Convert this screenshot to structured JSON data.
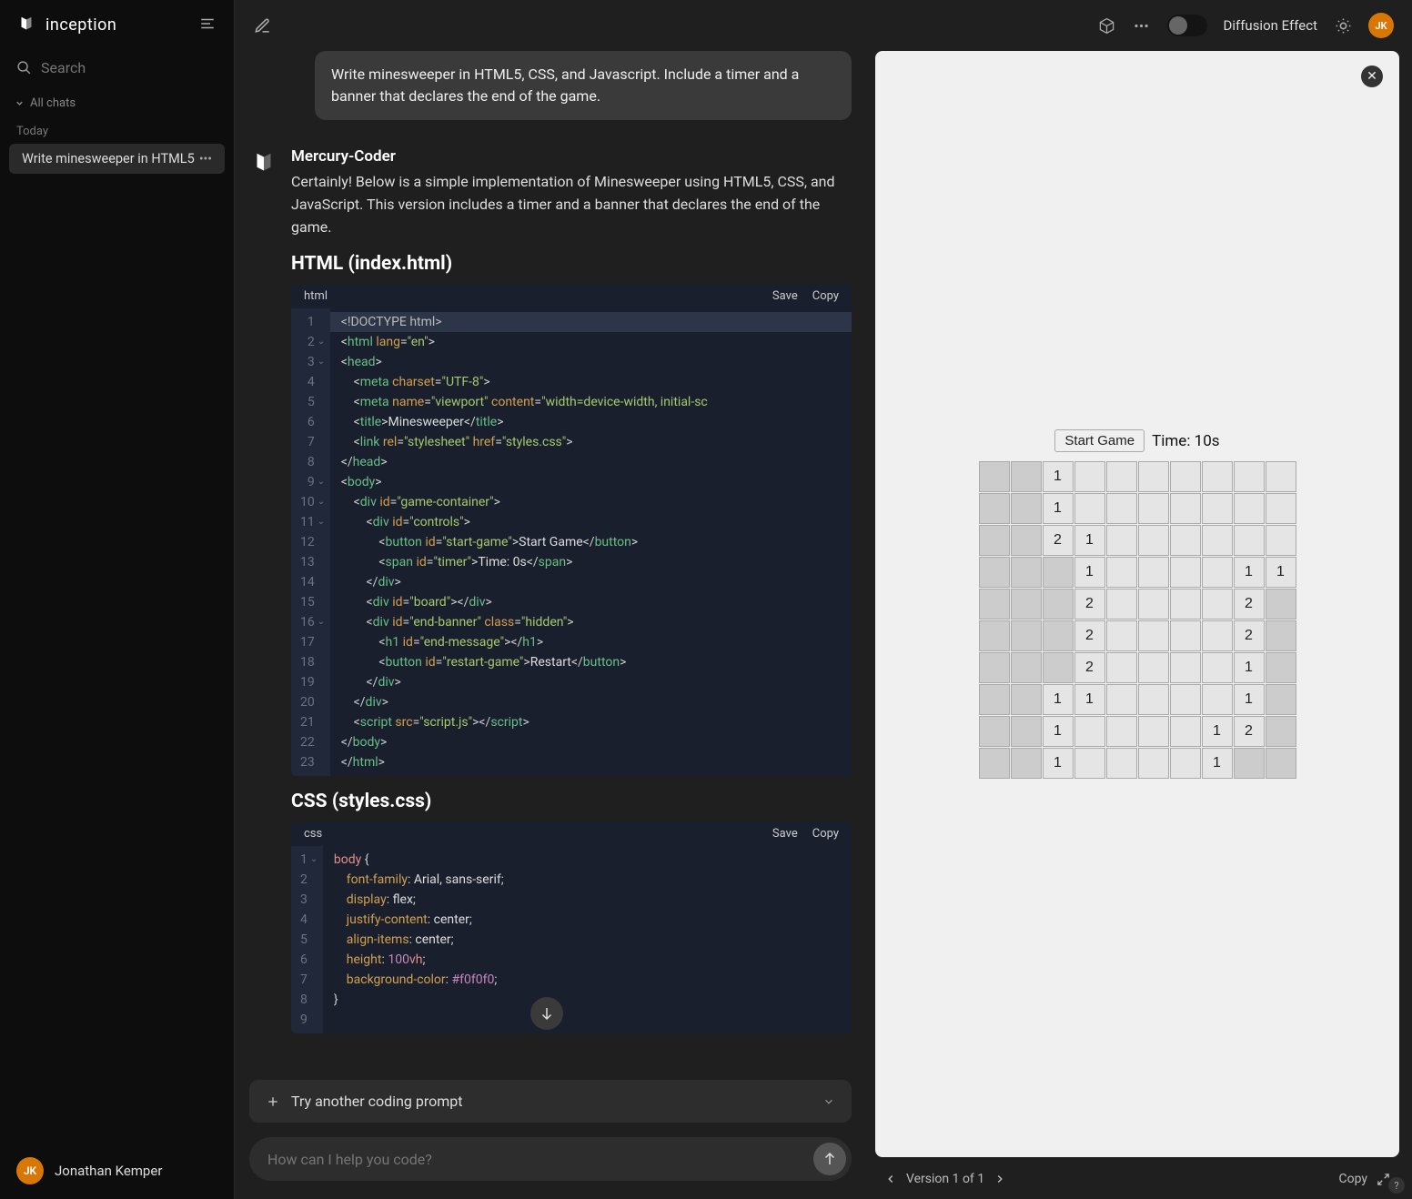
{
  "brand": {
    "name": "inception"
  },
  "search": {
    "placeholder": "Search"
  },
  "chats": {
    "header": "All chats",
    "date_group": "Today",
    "items": [
      {
        "title": "Write minesweeper in HTML5"
      }
    ]
  },
  "user": {
    "initials": "JK",
    "name": "Jonathan Kemper"
  },
  "topbar": {
    "toggle_label": "Diffusion Effect"
  },
  "conversation": {
    "user_message": "Write minesweeper in HTML5, CSS, and Javascript. Include a timer and a banner that declares the end of the game.",
    "assistant_name": "Mercury-Coder",
    "assistant_text": "Certainly! Below is a simple implementation of Minesweeper using HTML5, CSS, and JavaScript. This version includes a timer and a banner that declares the end of the game.",
    "section_html": "HTML (index.html)",
    "section_css": "CSS (styles.css)"
  },
  "code_html": {
    "lang": "html",
    "actions": {
      "save": "Save",
      "copy": "Copy"
    },
    "highlight_line": 1,
    "carets": [
      2,
      3,
      9,
      10,
      11,
      16
    ],
    "lines": [
      [
        [
          "doctype",
          "<!DOCTYPE html>"
        ]
      ],
      [
        [
          "punct",
          "<"
        ],
        [
          "tag",
          "html"
        ],
        [
          "text",
          " "
        ],
        [
          "attr",
          "lang"
        ],
        [
          "punct",
          "="
        ],
        [
          "str",
          "\"en\""
        ],
        [
          "punct",
          ">"
        ]
      ],
      [
        [
          "punct",
          "<"
        ],
        [
          "tag",
          "head"
        ],
        [
          "punct",
          ">"
        ]
      ],
      [
        [
          "text",
          "    "
        ],
        [
          "punct",
          "<"
        ],
        [
          "tag",
          "meta"
        ],
        [
          "text",
          " "
        ],
        [
          "attr",
          "charset"
        ],
        [
          "punct",
          "="
        ],
        [
          "str",
          "\"UTF-8\""
        ],
        [
          "punct",
          ">"
        ]
      ],
      [
        [
          "text",
          "    "
        ],
        [
          "punct",
          "<"
        ],
        [
          "tag",
          "meta"
        ],
        [
          "text",
          " "
        ],
        [
          "attr",
          "name"
        ],
        [
          "punct",
          "="
        ],
        [
          "str",
          "\"viewport\""
        ],
        [
          "text",
          " "
        ],
        [
          "attr",
          "content"
        ],
        [
          "punct",
          "="
        ],
        [
          "str",
          "\"width=device-width, initial-sc"
        ]
      ],
      [
        [
          "text",
          "    "
        ],
        [
          "punct",
          "<"
        ],
        [
          "tag",
          "title"
        ],
        [
          "punct",
          ">"
        ],
        [
          "text",
          "Minesweeper"
        ],
        [
          "punct",
          "</"
        ],
        [
          "tag",
          "title"
        ],
        [
          "punct",
          ">"
        ]
      ],
      [
        [
          "text",
          "    "
        ],
        [
          "punct",
          "<"
        ],
        [
          "tag",
          "link"
        ],
        [
          "text",
          " "
        ],
        [
          "attr",
          "rel"
        ],
        [
          "punct",
          "="
        ],
        [
          "str",
          "\"stylesheet\""
        ],
        [
          "text",
          " "
        ],
        [
          "attr",
          "href"
        ],
        [
          "punct",
          "="
        ],
        [
          "str",
          "\"styles.css\""
        ],
        [
          "punct",
          ">"
        ]
      ],
      [
        [
          "punct",
          "</"
        ],
        [
          "tag",
          "head"
        ],
        [
          "punct",
          ">"
        ]
      ],
      [
        [
          "punct",
          "<"
        ],
        [
          "tag",
          "body"
        ],
        [
          "punct",
          ">"
        ]
      ],
      [
        [
          "text",
          "    "
        ],
        [
          "punct",
          "<"
        ],
        [
          "tag",
          "div"
        ],
        [
          "text",
          " "
        ],
        [
          "attr",
          "id"
        ],
        [
          "punct",
          "="
        ],
        [
          "str",
          "\"game-container\""
        ],
        [
          "punct",
          ">"
        ]
      ],
      [
        [
          "text",
          "        "
        ],
        [
          "punct",
          "<"
        ],
        [
          "tag",
          "div"
        ],
        [
          "text",
          " "
        ],
        [
          "attr",
          "id"
        ],
        [
          "punct",
          "="
        ],
        [
          "str",
          "\"controls\""
        ],
        [
          "punct",
          ">"
        ]
      ],
      [
        [
          "text",
          "            "
        ],
        [
          "punct",
          "<"
        ],
        [
          "tag",
          "button"
        ],
        [
          "text",
          " "
        ],
        [
          "attr",
          "id"
        ],
        [
          "punct",
          "="
        ],
        [
          "str",
          "\"start-game\""
        ],
        [
          "punct",
          ">"
        ],
        [
          "text",
          "Start Game"
        ],
        [
          "punct",
          "</"
        ],
        [
          "tag",
          "button"
        ],
        [
          "punct",
          ">"
        ]
      ],
      [
        [
          "text",
          "            "
        ],
        [
          "punct",
          "<"
        ],
        [
          "tag",
          "span"
        ],
        [
          "text",
          " "
        ],
        [
          "attr",
          "id"
        ],
        [
          "punct",
          "="
        ],
        [
          "str",
          "\"timer\""
        ],
        [
          "punct",
          ">"
        ],
        [
          "text",
          "Time: 0s"
        ],
        [
          "punct",
          "</"
        ],
        [
          "tag",
          "span"
        ],
        [
          "punct",
          ">"
        ]
      ],
      [
        [
          "text",
          "        "
        ],
        [
          "punct",
          "</"
        ],
        [
          "tag",
          "div"
        ],
        [
          "punct",
          ">"
        ]
      ],
      [
        [
          "text",
          "        "
        ],
        [
          "punct",
          "<"
        ],
        [
          "tag",
          "div"
        ],
        [
          "text",
          " "
        ],
        [
          "attr",
          "id"
        ],
        [
          "punct",
          "="
        ],
        [
          "str",
          "\"board\""
        ],
        [
          "punct",
          "></"
        ],
        [
          "tag",
          "div"
        ],
        [
          "punct",
          ">"
        ]
      ],
      [
        [
          "text",
          "        "
        ],
        [
          "punct",
          "<"
        ],
        [
          "tag",
          "div"
        ],
        [
          "text",
          " "
        ],
        [
          "attr",
          "id"
        ],
        [
          "punct",
          "="
        ],
        [
          "str",
          "\"end-banner\""
        ],
        [
          "text",
          " "
        ],
        [
          "attr",
          "class"
        ],
        [
          "punct",
          "="
        ],
        [
          "str",
          "\"hidden\""
        ],
        [
          "punct",
          ">"
        ]
      ],
      [
        [
          "text",
          "            "
        ],
        [
          "punct",
          "<"
        ],
        [
          "tag",
          "h1"
        ],
        [
          "text",
          " "
        ],
        [
          "attr",
          "id"
        ],
        [
          "punct",
          "="
        ],
        [
          "str",
          "\"end-message\""
        ],
        [
          "punct",
          "></"
        ],
        [
          "tag",
          "h1"
        ],
        [
          "punct",
          ">"
        ]
      ],
      [
        [
          "text",
          "            "
        ],
        [
          "punct",
          "<"
        ],
        [
          "tag",
          "button"
        ],
        [
          "text",
          " "
        ],
        [
          "attr",
          "id"
        ],
        [
          "punct",
          "="
        ],
        [
          "str",
          "\"restart-game\""
        ],
        [
          "punct",
          ">"
        ],
        [
          "text",
          "Restart"
        ],
        [
          "punct",
          "</"
        ],
        [
          "tag",
          "button"
        ],
        [
          "punct",
          ">"
        ]
      ],
      [
        [
          "text",
          "        "
        ],
        [
          "punct",
          "</"
        ],
        [
          "tag",
          "div"
        ],
        [
          "punct",
          ">"
        ]
      ],
      [
        [
          "text",
          "    "
        ],
        [
          "punct",
          "</"
        ],
        [
          "tag",
          "div"
        ],
        [
          "punct",
          ">"
        ]
      ],
      [
        [
          "text",
          "    "
        ],
        [
          "punct",
          "<"
        ],
        [
          "tag",
          "script"
        ],
        [
          "text",
          " "
        ],
        [
          "attr",
          "src"
        ],
        [
          "punct",
          "="
        ],
        [
          "str",
          "\"script.js\""
        ],
        [
          "punct",
          "></"
        ],
        [
          "tag",
          "script"
        ],
        [
          "punct",
          ">"
        ]
      ],
      [
        [
          "punct",
          "</"
        ],
        [
          "tag",
          "body"
        ],
        [
          "punct",
          ">"
        ]
      ],
      [
        [
          "punct",
          "</"
        ],
        [
          "tag",
          "html"
        ],
        [
          "punct",
          ">"
        ]
      ]
    ]
  },
  "code_css": {
    "lang": "css",
    "actions": {
      "save": "Save",
      "copy": "Copy"
    },
    "carets": [
      1
    ],
    "lines": [
      [
        [
          "sel",
          "body"
        ],
        [
          "text",
          " "
        ],
        [
          "punct",
          "{"
        ]
      ],
      [
        [
          "text",
          "    "
        ],
        [
          "prop",
          "font-family"
        ],
        [
          "punct",
          ":"
        ],
        [
          "text",
          " Arial, sans-serif"
        ],
        [
          "punct",
          ";"
        ]
      ],
      [
        [
          "text",
          "    "
        ],
        [
          "prop",
          "display"
        ],
        [
          "punct",
          ":"
        ],
        [
          "text",
          " flex"
        ],
        [
          "punct",
          ";"
        ]
      ],
      [
        [
          "text",
          "    "
        ],
        [
          "prop",
          "justify-content"
        ],
        [
          "punct",
          ":"
        ],
        [
          "text",
          " center"
        ],
        [
          "punct",
          ";"
        ]
      ],
      [
        [
          "text",
          "    "
        ],
        [
          "prop",
          "align-items"
        ],
        [
          "punct",
          ":"
        ],
        [
          "text",
          " center"
        ],
        [
          "punct",
          ";"
        ]
      ],
      [
        [
          "text",
          "    "
        ],
        [
          "prop",
          "height"
        ],
        [
          "punct",
          ":"
        ],
        [
          "text",
          " "
        ],
        [
          "num",
          "100"
        ],
        [
          "unit",
          "vh"
        ],
        [
          "punct",
          ";"
        ]
      ],
      [
        [
          "text",
          "    "
        ],
        [
          "prop",
          "background-color"
        ],
        [
          "punct",
          ":"
        ],
        [
          "text",
          " "
        ],
        [
          "hex",
          "#f0f0f0"
        ],
        [
          "punct",
          ";"
        ]
      ],
      [
        [
          "punct",
          "}"
        ]
      ],
      [
        [
          "text",
          ""
        ]
      ]
    ]
  },
  "suggest": {
    "label": "Try another coding prompt"
  },
  "input": {
    "placeholder": "How can I help you code?"
  },
  "preview": {
    "start_label": "Start Game",
    "timer_prefix": "Time: ",
    "timer_value": "10s",
    "board": [
      [
        "",
        "",
        "1",
        "",
        "",
        "",
        "",
        "",
        "",
        ""
      ],
      [
        "",
        "",
        "1",
        "",
        "",
        "",
        "",
        "",
        "",
        ""
      ],
      [
        "",
        "",
        "2",
        "1",
        "",
        "",
        "",
        "",
        "",
        ""
      ],
      [
        "",
        "",
        "",
        "1",
        "",
        "",
        "",
        "",
        "1",
        "1"
      ],
      [
        "",
        "",
        "",
        "2",
        "",
        "",
        "",
        "",
        "2",
        ""
      ],
      [
        "",
        "",
        "",
        "2",
        "",
        "",
        "",
        "",
        "2",
        ""
      ],
      [
        "",
        "",
        "",
        "2",
        "",
        "",
        "",
        "",
        "1",
        ""
      ],
      [
        "",
        "",
        "1",
        "1",
        "",
        "",
        "",
        "",
        "1",
        ""
      ],
      [
        "",
        "",
        "1",
        "",
        "",
        "",
        "",
        "1",
        "2",
        ""
      ],
      [
        "",
        "",
        "1",
        "",
        "",
        "",
        "",
        "1",
        "",
        ""
      ]
    ],
    "revealed": [
      [
        0,
        0,
        1,
        1,
        1,
        1,
        1,
        1,
        1,
        1
      ],
      [
        0,
        0,
        1,
        1,
        1,
        1,
        1,
        1,
        1,
        1
      ],
      [
        0,
        0,
        1,
        1,
        1,
        1,
        1,
        1,
        1,
        1
      ],
      [
        0,
        0,
        0,
        1,
        1,
        1,
        1,
        1,
        1,
        1
      ],
      [
        0,
        0,
        0,
        1,
        1,
        1,
        1,
        1,
        1,
        0
      ],
      [
        0,
        0,
        0,
        1,
        1,
        1,
        1,
        1,
        1,
        0
      ],
      [
        0,
        0,
        0,
        1,
        1,
        1,
        1,
        1,
        1,
        0
      ],
      [
        0,
        0,
        1,
        1,
        1,
        1,
        1,
        1,
        1,
        0
      ],
      [
        0,
        0,
        1,
        1,
        1,
        1,
        1,
        1,
        1,
        0
      ],
      [
        0,
        0,
        1,
        1,
        1,
        1,
        1,
        1,
        0,
        0
      ]
    ],
    "version_label": "Version 1 of 1",
    "copy_label": "Copy"
  },
  "help": "?"
}
